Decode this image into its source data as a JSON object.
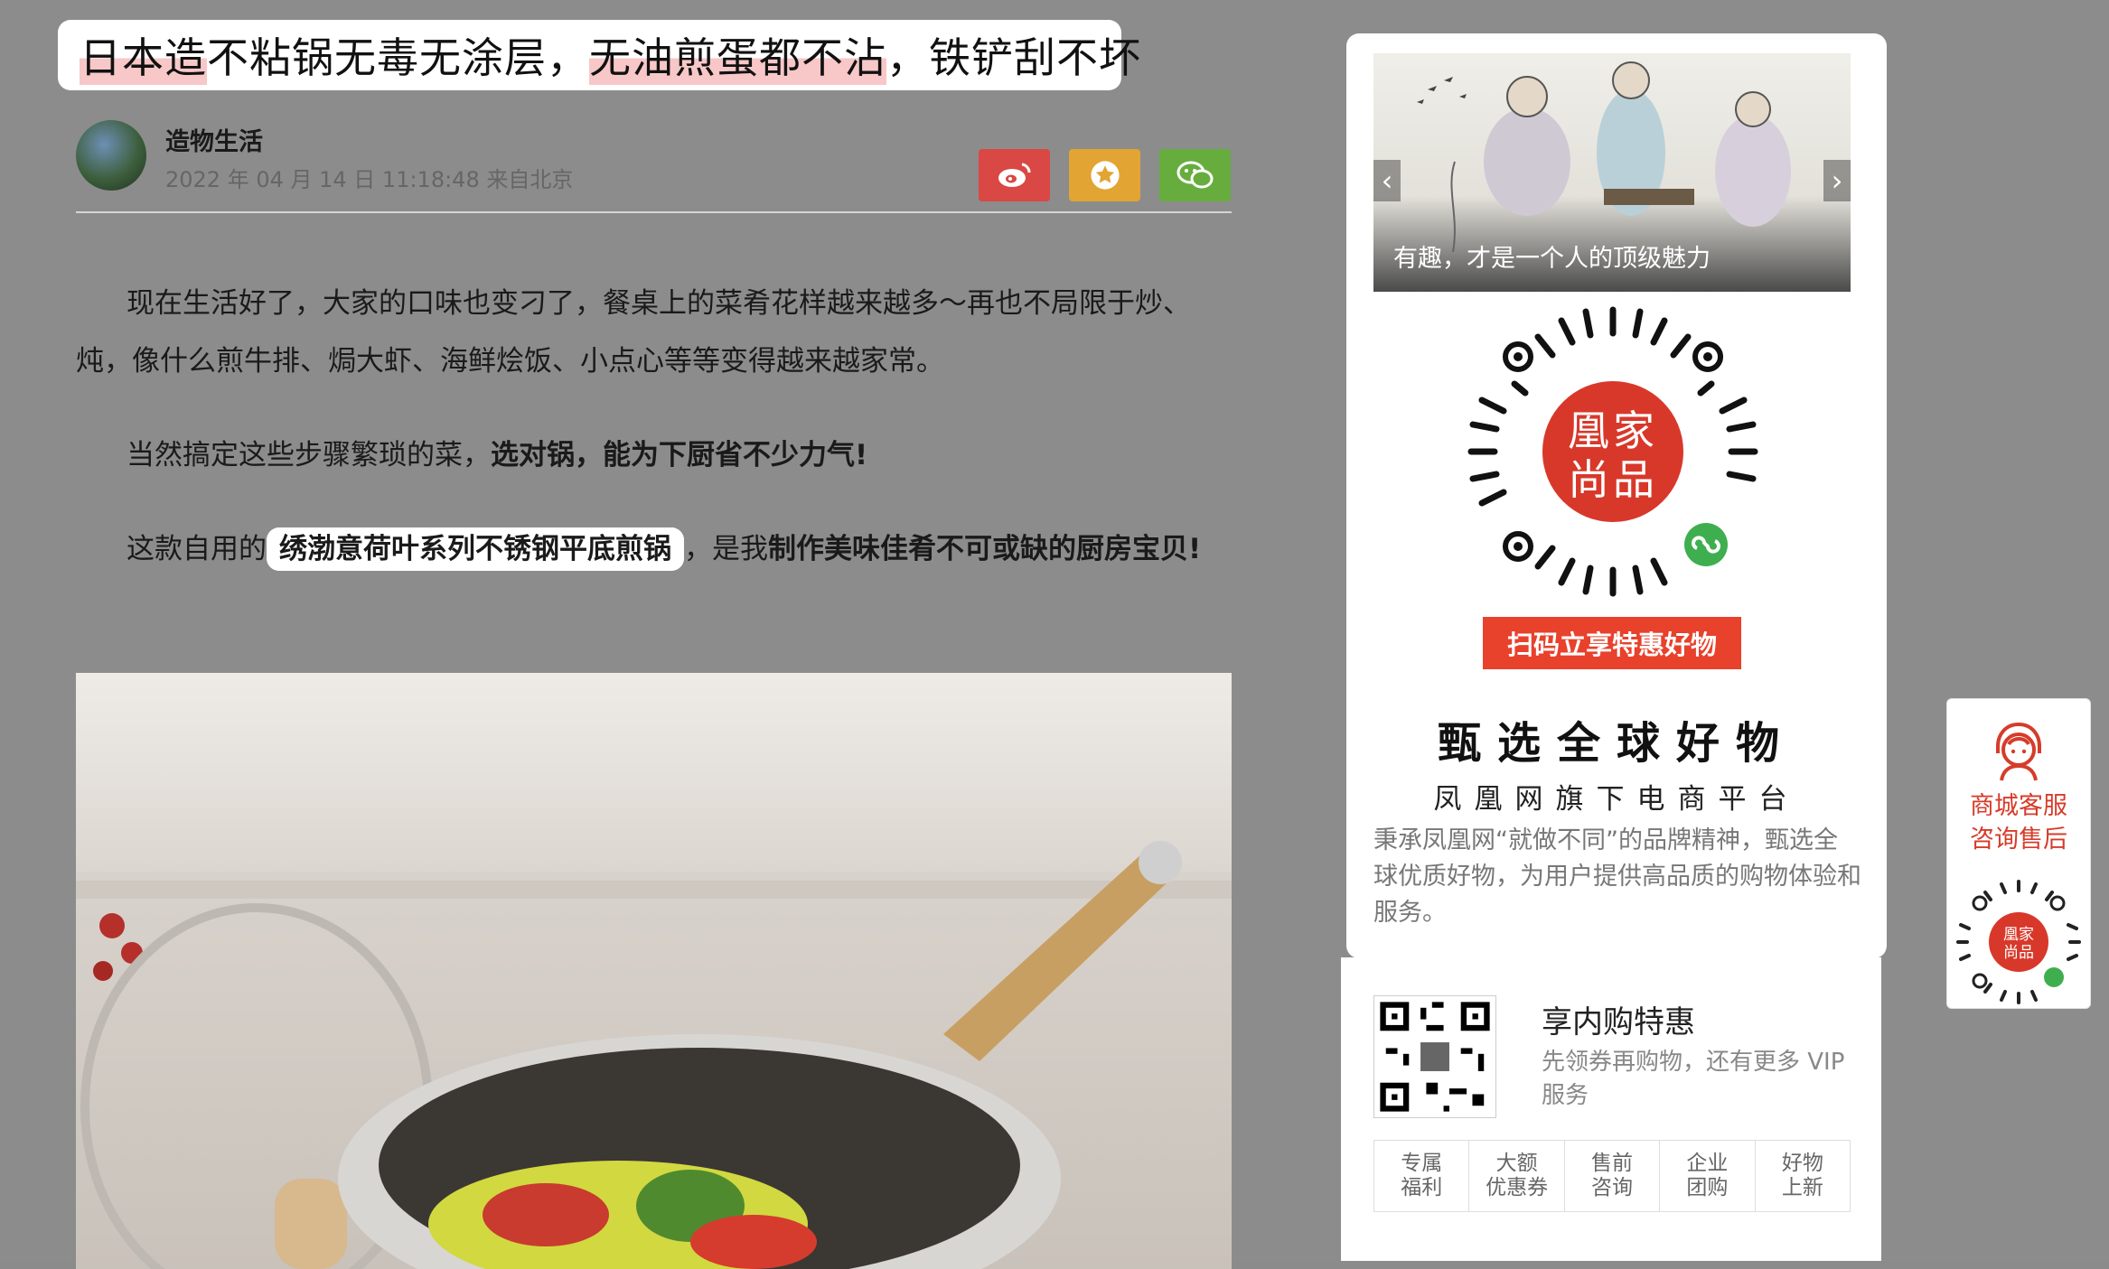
{
  "article": {
    "title": {
      "part1": "日本造",
      "part2": "不粘锅无毒无涂层，",
      "part3": "无油煎蛋都不沾",
      "part4": "，铁铲刮不坏"
    },
    "author": {
      "name": "造物生活",
      "meta": "2022 年 04 月 14 日 11:18:48 来自北京"
    },
    "share": {
      "weibo_icon": "weibo-icon",
      "favorite_icon": "star-icon",
      "wechat_icon": "wechat-icon"
    },
    "paragraphs": {
      "p1": "现在生活好了，大家的口味也变刁了，餐桌上的菜肴花样越来越多～再也不局限于炒、炖，像什么煎牛排、焗大虾、海鲜烩饭、小点心等等变得越来越家常。",
      "p2_normal": "当然搞定这些步骤繁琐的菜，",
      "p2_bold": "选对锅，能为下厨省不少力气!",
      "p3_pre": "这款自用的",
      "p3_highlight": "绣渤意荷叶系列不锈钢平底煎锅",
      "p3_mid": "，是我",
      "p3_bold": "制作美味佳肴不可或缺的厨房宝贝!"
    }
  },
  "sidebar": {
    "banner": {
      "caption": "有趣，才是一个人的顶级魅力",
      "prev_icon": "chevron-left-icon",
      "next_icon": "chevron-right-icon"
    },
    "qr_logo": {
      "line1": "凰家",
      "line2": "尚品"
    },
    "scan_button": "扫码立享特惠好物",
    "slogan_main": "甄选全球好物",
    "slogan_sub": "凤凰网旗下电商平台",
    "description": "秉承凤凰网“就做不同”的品牌精神，甄选全球优质好物，为用户提供高品质的购物体验和服务。"
  },
  "member": {
    "title": "享内购特惠",
    "subtitle": "先领券再购物，还有更多 VIP 服务",
    "perks": [
      "专属\n福利",
      "大额\n优惠券",
      "售前\n咨询",
      "企业\n团购",
      "好物\n上新"
    ]
  },
  "service": {
    "label": "商城客服\n咨询售后",
    "icon": "customer-service-icon"
  },
  "colors": {
    "accent_red": "#e8412c",
    "weibo": "#d94844",
    "favorite": "#e2a432",
    "wechat": "#66ad3e"
  }
}
